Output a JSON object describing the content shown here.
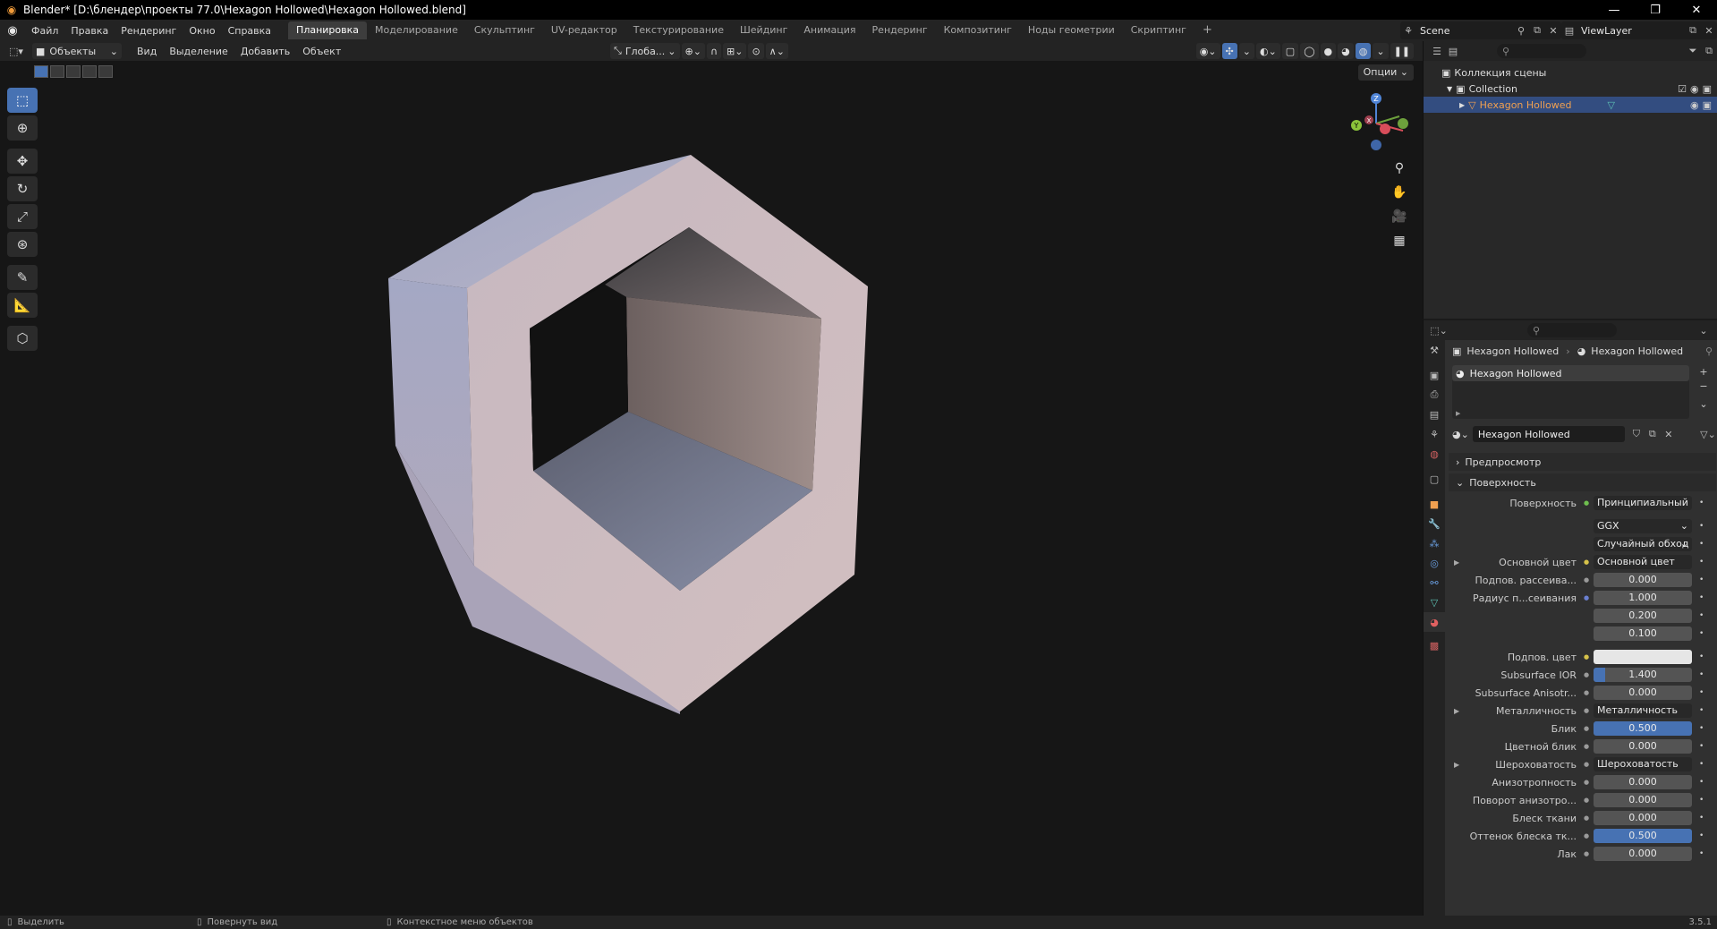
{
  "window": {
    "title": "Blender* [D:\\блендер\\проекты 77.0\\Hexagon Hollowed\\Hexagon Hollowed.blend]",
    "minimize": "—",
    "maximize": "❐",
    "close": "✕"
  },
  "topbar": {
    "menus": [
      "Файл",
      "Правка",
      "Рендеринг",
      "Окно",
      "Справка"
    ],
    "tabs": [
      "Планировка",
      "Моделирование",
      "Скульптинг",
      "UV-редактор",
      "Текстурирование",
      "Шейдинг",
      "Анимация",
      "Рендеринг",
      "Композитинг",
      "Ноды геометрии",
      "Скриптинг"
    ],
    "active_tab": 0,
    "add_tab": "+",
    "scene": "Scene",
    "view_layer": "ViewLayer"
  },
  "viewport_header": {
    "mode": "Объекты",
    "menus": [
      "Вид",
      "Выделение",
      "Добавить",
      "Объект"
    ],
    "orientation": "Глоба...",
    "options": "Опции"
  },
  "gizmo": {
    "z": "Z",
    "y": "Y",
    "x": "X"
  },
  "outliner": {
    "scene_collection": "Коллекция сцены",
    "collection": "Collection",
    "object": "Hexagon Hollowed"
  },
  "properties": {
    "breadcrumb_object": "Hexagon Hollowed",
    "breadcrumb_material": "Hexagon Hollowed",
    "slot": "Hexagon Hollowed",
    "material_name": "Hexagon Hollowed",
    "panel_preview": "Предпросмотр",
    "panel_surface": "Поверхность",
    "rows": [
      {
        "label": "Поверхность",
        "value": "Принципиальный BSDF",
        "style": "dark",
        "dot": "green"
      },
      {
        "label": "",
        "value": "GGX",
        "style": "dark",
        "dot": "none",
        "dropdown": true
      },
      {
        "label": "",
        "value": "Случайный обход",
        "style": "dark",
        "dot": "none",
        "dropdown": true
      },
      {
        "label": "Основной цвет",
        "value": "Основной цвет",
        "style": "dark",
        "dot": "yellow",
        "expand": true
      },
      {
        "label": "Подпов. рассеива...",
        "value": "0.000",
        "style": "num",
        "dot": "grey"
      },
      {
        "label": "Радиус п...сеивания",
        "value": "1.000",
        "style": "num",
        "dot": "blue"
      },
      {
        "label": "",
        "value": "0.200",
        "style": "num",
        "dot": "none"
      },
      {
        "label": "",
        "value": "0.100",
        "style": "num",
        "dot": "none"
      },
      {
        "label": "Подпов. цвет",
        "value": "",
        "style": "white",
        "dot": "yellow"
      },
      {
        "label": "Subsurface IOR",
        "value": "1.400",
        "style": "num",
        "dot": "grey",
        "fill": 0.12
      },
      {
        "label": "Subsurface Anisotr...",
        "value": "0.000",
        "style": "num",
        "dot": "grey"
      },
      {
        "label": "Металличность",
        "value": "Металличность",
        "style": "dark",
        "dot": "grey",
        "expand": true
      },
      {
        "label": "Блик",
        "value": "0.500",
        "style": "blue",
        "dot": "grey"
      },
      {
        "label": "Цветной блик",
        "value": "0.000",
        "style": "num",
        "dot": "grey"
      },
      {
        "label": "Шероховатость",
        "value": "Шероховатость",
        "style": "dark",
        "dot": "grey",
        "expand": true
      },
      {
        "label": "Анизотропность",
        "value": "0.000",
        "style": "num",
        "dot": "grey"
      },
      {
        "label": "Поворот анизотро...",
        "value": "0.000",
        "style": "num",
        "dot": "grey"
      },
      {
        "label": "Блеск ткани",
        "value": "0.000",
        "style": "num",
        "dot": "grey"
      },
      {
        "label": "Оттенок блеска тк...",
        "value": "0.500",
        "style": "blue",
        "dot": "grey"
      },
      {
        "label": "Лак",
        "value": "0.000",
        "style": "num",
        "dot": "grey"
      }
    ]
  },
  "statusbar": {
    "select": "Выделить",
    "rotate": "Повернуть вид",
    "context": "Контекстное меню объектов",
    "version": "3.5.1"
  },
  "colors": {
    "accent": "#4772b3",
    "selected_row": "#334d80",
    "object_name": "#f0a050"
  }
}
